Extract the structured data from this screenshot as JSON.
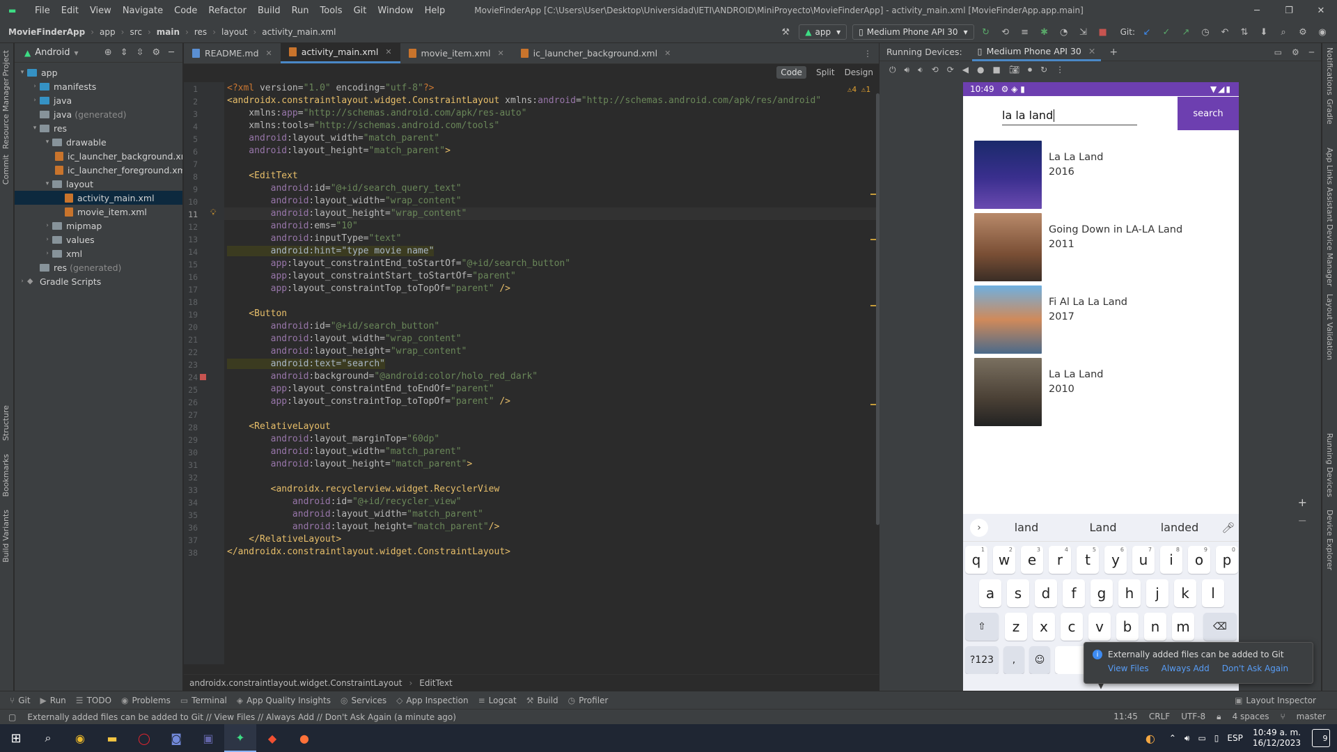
{
  "titlebar": {
    "menus": [
      "File",
      "Edit",
      "View",
      "Navigate",
      "Code",
      "Refactor",
      "Build",
      "Run",
      "Tools",
      "Git",
      "Window",
      "Help"
    ],
    "title": "MovieFinderApp [C:\\Users\\User\\Desktop\\Universidad\\IETI\\ANDROID\\MiniProyecto\\MovieFinderApp] - activity_main.xml [MovieFinderApp.app.main]"
  },
  "navbar": {
    "crumbs": [
      "MovieFinderApp",
      "app",
      "src",
      "main",
      "res",
      "layout",
      "activity_main.xml"
    ],
    "run_config": "app",
    "device": "Medium Phone API 30",
    "git_label": "Git:"
  },
  "project": {
    "view": "Android",
    "tree": [
      {
        "label": "app",
        "kind": "folder-blue",
        "depth": 0,
        "arrow": "▾"
      },
      {
        "label": "manifests",
        "kind": "folder-blue",
        "depth": 1,
        "arrow": "›"
      },
      {
        "label": "java",
        "kind": "folder-blue",
        "depth": 1,
        "arrow": "›"
      },
      {
        "label": "java",
        "muted": "(generated)",
        "kind": "folder",
        "depth": 1,
        "arrow": ""
      },
      {
        "label": "res",
        "kind": "folder",
        "depth": 1,
        "arrow": "▾"
      },
      {
        "label": "drawable",
        "kind": "folder",
        "depth": 2,
        "arrow": "▾"
      },
      {
        "label": "ic_launcher_background.xml",
        "kind": "xml",
        "depth": 3,
        "arrow": ""
      },
      {
        "label": "ic_launcher_foreground.xml",
        "kind": "xml",
        "depth": 3,
        "arrow": ""
      },
      {
        "label": "layout",
        "kind": "folder",
        "depth": 2,
        "arrow": "▾"
      },
      {
        "label": "activity_main.xml",
        "kind": "xml",
        "depth": 3,
        "arrow": "",
        "selected": true
      },
      {
        "label": "movie_item.xml",
        "kind": "xml",
        "depth": 3,
        "arrow": ""
      },
      {
        "label": "mipmap",
        "kind": "folder",
        "depth": 2,
        "arrow": "›"
      },
      {
        "label": "values",
        "kind": "folder",
        "depth": 2,
        "arrow": "›"
      },
      {
        "label": "xml",
        "kind": "folder",
        "depth": 2,
        "arrow": "›"
      },
      {
        "label": "res",
        "muted": "(generated)",
        "kind": "folder",
        "depth": 1,
        "arrow": ""
      },
      {
        "label": "Gradle Scripts",
        "kind": "gradle",
        "depth": 0,
        "arrow": "›"
      }
    ]
  },
  "left_strip": [
    "Project",
    "Resource Manager",
    "Commit",
    "Structure",
    "Bookmarks",
    "Build Variants"
  ],
  "right_strip": [
    "Notifications",
    "Gradle",
    "App Links Assistant",
    "Device Manager",
    "Layout Validation",
    "Running Devices",
    "Device Explorer"
  ],
  "editor": {
    "tabs": [
      {
        "label": "README.md",
        "type": "md"
      },
      {
        "label": "activity_main.xml",
        "type": "xml",
        "active": true
      },
      {
        "label": "movie_item.xml",
        "type": "xml"
      },
      {
        "label": "ic_launcher_background.xml",
        "type": "xml"
      }
    ],
    "modes": [
      "Code",
      "Split",
      "Design"
    ],
    "inspection_summary": "⚠4  ⚠1",
    "current_line": 11,
    "lines": [
      [
        [
          "p",
          "<?xml "
        ],
        [
          "a",
          "version="
        ],
        [
          "v",
          "\"1.0\""
        ],
        [
          "a",
          " encoding="
        ],
        [
          "v",
          "\"utf-8\""
        ],
        [
          "p",
          "?>"
        ]
      ],
      [
        [
          "t",
          "<androidx.constraintlayout.widget.ConstraintLayout"
        ],
        [
          "a",
          " xmlns:"
        ],
        [
          "ns",
          "android"
        ],
        [
          "a",
          "="
        ],
        [
          "v",
          "\"http://schemas.android.com/apk/res/android\""
        ]
      ],
      [
        [
          "a",
          "    xmlns:"
        ],
        [
          "ns",
          "app"
        ],
        [
          "a",
          "="
        ],
        [
          "v",
          "\"http://schemas.android.com/apk/res-auto\""
        ]
      ],
      [
        [
          "a",
          "    xmlns:tools="
        ],
        [
          "v",
          "\"http://schemas.android.com/tools\""
        ]
      ],
      [
        [
          "ns",
          "    android"
        ],
        [
          "a",
          ":layout_width="
        ],
        [
          "v",
          "\"match_parent\""
        ]
      ],
      [
        [
          "ns",
          "    android"
        ],
        [
          "a",
          ":layout_height="
        ],
        [
          "v",
          "\"match_parent\""
        ],
        [
          "t",
          ">"
        ]
      ],
      [],
      [
        [
          "t",
          "    <EditText"
        ]
      ],
      [
        [
          "ns",
          "        android"
        ],
        [
          "a",
          ":id="
        ],
        [
          "v",
          "\"@+id/search_query_text\""
        ]
      ],
      [
        [
          "ns",
          "        android"
        ],
        [
          "a",
          ":layout_width="
        ],
        [
          "v",
          "\"wrap_content\""
        ]
      ],
      [
        [
          "ns",
          "        android"
        ],
        [
          "a",
          ":layout_height="
        ],
        [
          "v",
          "\"wrap_content\""
        ]
      ],
      [
        [
          "ns",
          "        android"
        ],
        [
          "a",
          ":ems="
        ],
        [
          "v",
          "\"10\""
        ]
      ],
      [
        [
          "ns",
          "        android"
        ],
        [
          "a",
          ":inputType="
        ],
        [
          "v",
          "\"text\""
        ]
      ],
      [
        [
          "hl",
          "        android:hint=\"type movie name\""
        ]
      ],
      [
        [
          "ns",
          "        app"
        ],
        [
          "a",
          ":layout_constraintEnd_toStartOf="
        ],
        [
          "v",
          "\"@+id/search_button\""
        ]
      ],
      [
        [
          "ns",
          "        app"
        ],
        [
          "a",
          ":layout_constraintStart_toStartOf="
        ],
        [
          "v",
          "\"parent\""
        ]
      ],
      [
        [
          "ns",
          "        app"
        ],
        [
          "a",
          ":layout_constraintTop_toTopOf="
        ],
        [
          "v",
          "\"parent\""
        ],
        [
          "t",
          " />"
        ]
      ],
      [],
      [
        [
          "t",
          "    <Button"
        ]
      ],
      [
        [
          "ns",
          "        android"
        ],
        [
          "a",
          ":id="
        ],
        [
          "v",
          "\"@+id/search_button\""
        ]
      ],
      [
        [
          "ns",
          "        android"
        ],
        [
          "a",
          ":layout_width="
        ],
        [
          "v",
          "\"wrap_content\""
        ]
      ],
      [
        [
          "ns",
          "        android"
        ],
        [
          "a",
          ":layout_height="
        ],
        [
          "v",
          "\"wrap_content\""
        ]
      ],
      [
        [
          "hl",
          "        android:text=\"search\""
        ]
      ],
      [
        [
          "ns",
          "        android"
        ],
        [
          "a",
          ":background="
        ],
        [
          "v",
          "\"@android:color/holo_red_dark\""
        ]
      ],
      [
        [
          "ns",
          "        app"
        ],
        [
          "a",
          ":layout_constraintEnd_toEndOf="
        ],
        [
          "v",
          "\"parent\""
        ]
      ],
      [
        [
          "ns",
          "        app"
        ],
        [
          "a",
          ":layout_constraintTop_toTopOf="
        ],
        [
          "v",
          "\"parent\""
        ],
        [
          "t",
          " />"
        ]
      ],
      [],
      [
        [
          "t",
          "    <RelativeLayout"
        ]
      ],
      [
        [
          "ns",
          "        android"
        ],
        [
          "a",
          ":layout_marginTop="
        ],
        [
          "v",
          "\"60dp\""
        ]
      ],
      [
        [
          "ns",
          "        android"
        ],
        [
          "a",
          ":layout_width="
        ],
        [
          "v",
          "\"match_parent\""
        ]
      ],
      [
        [
          "ns",
          "        android"
        ],
        [
          "a",
          ":layout_height="
        ],
        [
          "v",
          "\"match_parent\""
        ],
        [
          "t",
          ">"
        ]
      ],
      [],
      [
        [
          "t",
          "        <androidx.recyclerview.widget.RecyclerView"
        ]
      ],
      [
        [
          "ns",
          "            android"
        ],
        [
          "a",
          ":id="
        ],
        [
          "v",
          "\"@+id/recycler_view\""
        ]
      ],
      [
        [
          "ns",
          "            android"
        ],
        [
          "a",
          ":layout_width="
        ],
        [
          "v",
          "\"match_parent\""
        ]
      ],
      [
        [
          "ns",
          "            android"
        ],
        [
          "a",
          ":layout_height="
        ],
        [
          "v",
          "\"match_parent\""
        ],
        [
          "t",
          "/>"
        ]
      ],
      [
        [
          "t",
          "    </RelativeLayout>"
        ]
      ],
      [
        [
          "t",
          "</androidx.constraintlayout.widget.ConstraintLayout>"
        ]
      ]
    ],
    "breadcrumb": [
      "androidx.constraintlayout.widget.ConstraintLayout",
      "EditText"
    ]
  },
  "devices": {
    "label": "Running Devices:",
    "tab": "Medium Phone API 30",
    "phone": {
      "time": "10:49",
      "query": "la la land",
      "search_label": "search",
      "movies": [
        {
          "title": "La La Land",
          "year": "2016",
          "poster": "#2b2a6e"
        },
        {
          "title": "Going Down in LA-LA Land",
          "year": "2011",
          "poster": "#8a5a3a"
        },
        {
          "title": "Fi Al La La Land",
          "year": "2017",
          "poster": "#4f86b8"
        },
        {
          "title": "La La Land",
          "year": "2010",
          "poster": "#5a5040"
        }
      ],
      "suggestions": [
        "land",
        "Land",
        "landed"
      ],
      "keyboard": {
        "row1": [
          "q",
          "w",
          "e",
          "r",
          "t",
          "y",
          "u",
          "i",
          "o",
          "p"
        ],
        "row1_nums": [
          "1",
          "2",
          "3",
          "4",
          "5",
          "6",
          "7",
          "8",
          "9",
          "0"
        ],
        "row2": [
          "a",
          "s",
          "d",
          "f",
          "g",
          "h",
          "j",
          "k",
          "l"
        ],
        "row3": [
          "z",
          "x",
          "c",
          "v",
          "b",
          "n",
          "m"
        ],
        "sym": "?123",
        "comma": ","
      }
    }
  },
  "notification": {
    "text": "Externally added files can be added to Git",
    "actions": [
      "View Files",
      "Always Add",
      "Don't Ask Again"
    ]
  },
  "bottom_tools": [
    "Git",
    "Run",
    "TODO",
    "Problems",
    "Terminal",
    "App Quality Insights",
    "Services",
    "App Inspection",
    "Logcat",
    "Build",
    "Profiler"
  ],
  "layout_inspector": "Layout Inspector",
  "status": {
    "message": "Externally added files can be added to Git // View Files // Always Add // Don't Ask Again (a minute ago)",
    "items": [
      "11:45",
      "CRLF",
      "UTF-8",
      "4 spaces",
      "master"
    ]
  },
  "taskbar": {
    "lang": "ESP",
    "time": "10:49 a. m.",
    "date": "16/12/2023",
    "notif_count": "9"
  }
}
